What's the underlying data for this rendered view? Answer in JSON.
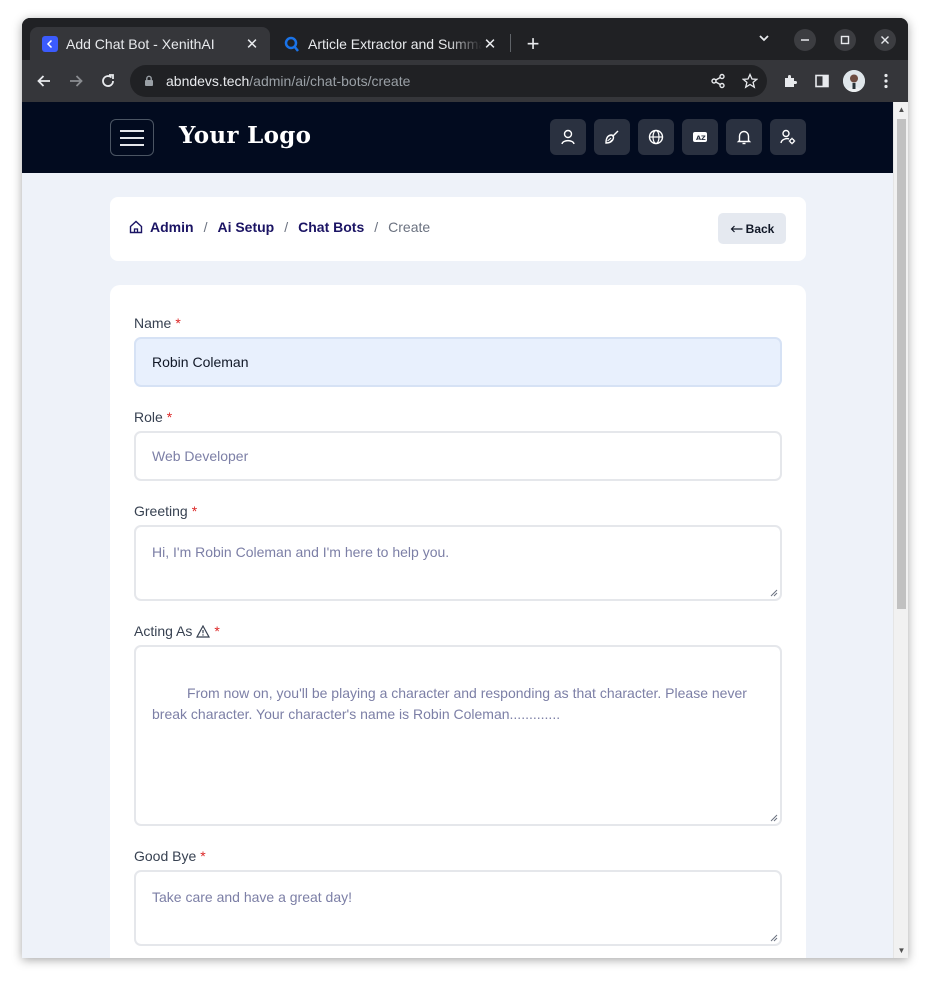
{
  "browser": {
    "tabs": [
      {
        "title": "Add Chat Bot - XenithAI",
        "active": true,
        "favicon_color": "#3b5bfd"
      },
      {
        "title": "Article Extractor and Summarizer",
        "active": false,
        "favicon_color": "#1a73e8"
      }
    ],
    "url_host": "abndevs.tech",
    "url_path": "/admin/ai/chat-bots/create"
  },
  "header": {
    "logo": "Your Logo",
    "icons": [
      "user-icon",
      "broom-icon",
      "globe-icon",
      "language-icon",
      "bell-icon",
      "user-settings-icon"
    ]
  },
  "breadcrumb": {
    "items": [
      "Admin",
      "Ai Setup",
      "Chat Bots"
    ],
    "current": "Create",
    "back_label": "Back"
  },
  "form": {
    "name": {
      "label": "Name",
      "value": "Robin Coleman"
    },
    "role": {
      "label": "Role",
      "placeholder": "Web Developer"
    },
    "greeting": {
      "label": "Greeting",
      "placeholder": "Hi, I'm Robin Coleman and I'm here to help you."
    },
    "acting_as": {
      "label": "Acting As",
      "placeholder": " From now on, you'll be playing a character and responding as that character. Please never break character. Your character's name is Robin Coleman............."
    },
    "good_bye": {
      "label": "Good Bye",
      "placeholder": "Take care and have a great day!"
    },
    "required_mark": "*"
  },
  "colors": {
    "header_bg": "#020b1f",
    "page_bg": "#eef2f9",
    "crumb_link": "#1b1464",
    "required": "#dc2626",
    "filled_field": "#e8f0fd"
  }
}
